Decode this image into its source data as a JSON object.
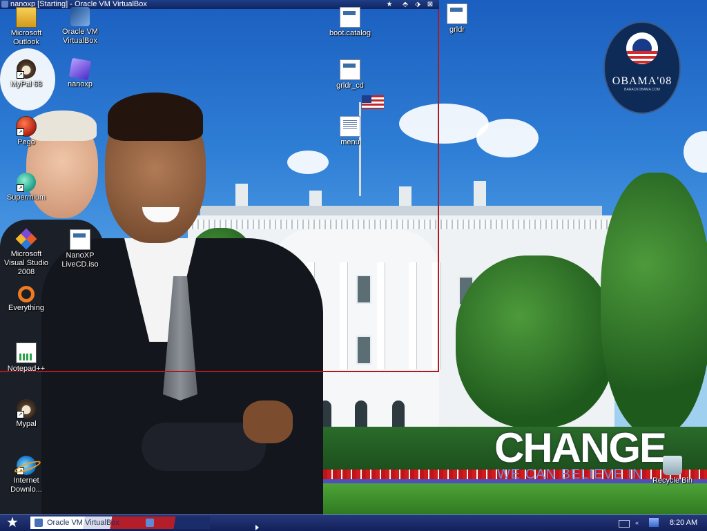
{
  "window": {
    "title": "nanoxp [Starting] - Oracle VM VirtualBox",
    "controls": [
      "★",
      "⬘",
      "⬗",
      "⊠"
    ]
  },
  "desktop_icons": [
    {
      "label": "Microsoft Outlook",
      "icon": "outlook-icon"
    },
    {
      "label": "Oracle VM VirtualBox",
      "icon": "virtualbox-icon"
    },
    {
      "label": "MyPal 68",
      "icon": "mypal-icon"
    },
    {
      "label": "nanoxp",
      "icon": "cube-icon"
    },
    {
      "label": "Pego",
      "icon": "pego-icon"
    },
    {
      "label": "Supermium",
      "icon": "supermium-icon"
    },
    {
      "label": "Microsoft Visual Studio 2008",
      "icon": "visual-studio-icon"
    },
    {
      "label": "NanoXP LiveCD.iso",
      "icon": "iso-file-icon"
    },
    {
      "label": "Everything",
      "icon": "everything-icon"
    },
    {
      "label": "Notepad++",
      "icon": "notepad-plus-icon"
    },
    {
      "label": "Mypal",
      "icon": "mypal-icon"
    },
    {
      "label": "Internet Downlo...",
      "icon": "internet-download-icon"
    },
    {
      "label": "boot.catalog",
      "icon": "file-icon"
    },
    {
      "label": "grldr_cd",
      "icon": "file-icon"
    },
    {
      "label": "menu",
      "icon": "document-icon"
    },
    {
      "label": "grldr",
      "icon": "file-icon"
    },
    {
      "label": "Recycle Bin",
      "icon": "recycle-bin-icon"
    }
  ],
  "wallpaper": {
    "logo_text": "OBAMA'08",
    "logo_subtext": "BARACKOBAMA.COM",
    "slogan_title": "CHANGE",
    "slogan_subtitle": "WE CAN BELIEVE IN"
  },
  "taskbar": {
    "start_symbol": "★",
    "task_label": "Oracle VM VirtualBox",
    "clock": "8:20 AM",
    "tray_arrow": "«"
  },
  "colors": {
    "taskbar": "#1a2a66",
    "window_border": "#b2191f",
    "title_bar": "#13306f"
  }
}
